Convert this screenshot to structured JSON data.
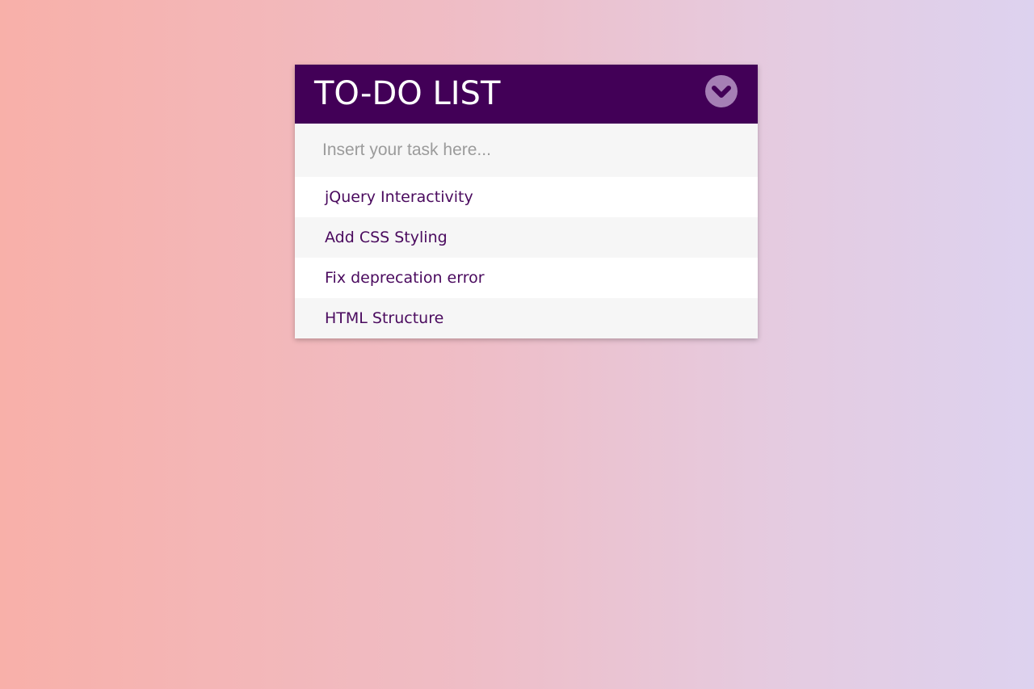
{
  "app": {
    "title": "TO-DO LIST",
    "toggle_icon": "chevron-down-circle-icon"
  },
  "input": {
    "placeholder": "Insert your task here...",
    "value": ""
  },
  "tasks": [
    "jQuery Interactivity",
    "Add CSS Styling",
    "Fix deprecation error",
    "HTML Structure"
  ],
  "colors": {
    "header_bg": "#420057",
    "task_text": "#4a0a5e",
    "toggle_bg": "#a57fb5",
    "row_alt_bg": "#f6f6f6"
  }
}
